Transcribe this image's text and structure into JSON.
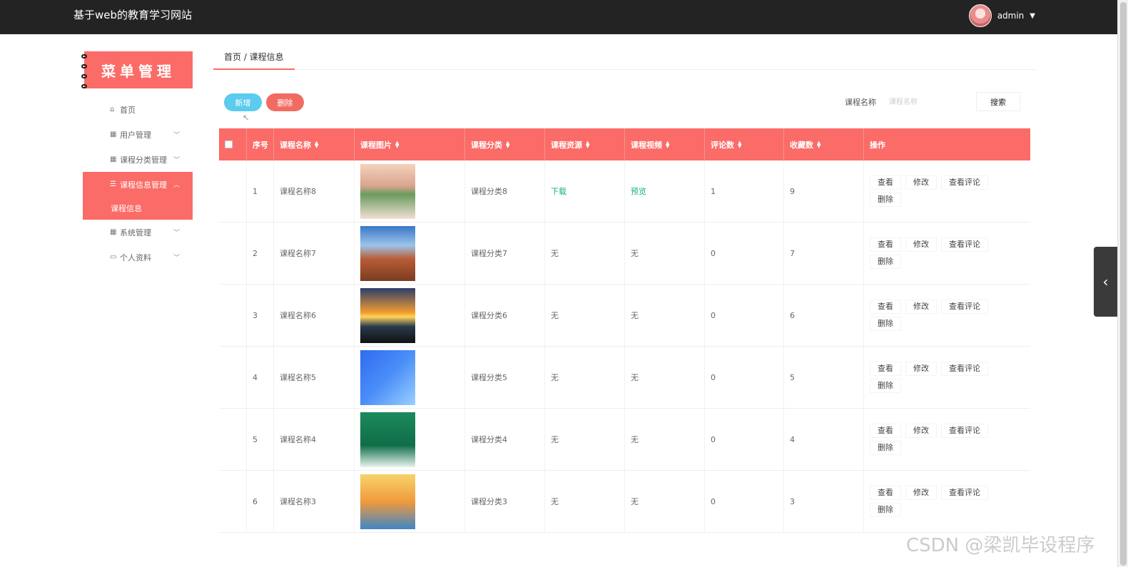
{
  "header": {
    "title": "基于web的教育学习网站",
    "username": "admin"
  },
  "sidebar": {
    "banner": "菜单管理",
    "items": [
      {
        "label": "首页",
        "icon": "home-icon"
      },
      {
        "label": "用户管理",
        "icon": "grid-icon"
      },
      {
        "label": "课程分类管理",
        "icon": "grid-icon"
      },
      {
        "label": "课程信息管理",
        "icon": "list-icon",
        "active": true,
        "sub": "课程信息"
      },
      {
        "label": "系统管理",
        "icon": "grid-icon"
      },
      {
        "label": "个人资料",
        "icon": "card-icon"
      }
    ]
  },
  "breadcrumb": "首页 / 课程信息",
  "toolbar": {
    "add_label": "新增",
    "delete_label": "删除",
    "search_label": "课程名称",
    "search_placeholder": "课程名称",
    "search_button": "搜索"
  },
  "table": {
    "columns": [
      "序号",
      "课程名称",
      "课程图片",
      "课程分类",
      "课程资源",
      "课程视频",
      "评论数",
      "收藏数",
      "操作"
    ],
    "ops": [
      "查看",
      "修改",
      "查看评论",
      "删除"
    ],
    "rows": [
      {
        "no": "1",
        "name": "课程名称8",
        "category": "课程分类8",
        "resource": "下载",
        "video": "预览",
        "comments": "1",
        "favorites": "9"
      },
      {
        "no": "2",
        "name": "课程名称7",
        "category": "课程分类7",
        "resource": "无",
        "video": "无",
        "comments": "0",
        "favorites": "7"
      },
      {
        "no": "3",
        "name": "课程名称6",
        "category": "课程分类6",
        "resource": "无",
        "video": "无",
        "comments": "0",
        "favorites": "6"
      },
      {
        "no": "4",
        "name": "课程名称5",
        "category": "课程分类5",
        "resource": "无",
        "video": "无",
        "comments": "0",
        "favorites": "5"
      },
      {
        "no": "5",
        "name": "课程名称4",
        "category": "课程分类4",
        "resource": "无",
        "video": "无",
        "comments": "0",
        "favorites": "4"
      },
      {
        "no": "6",
        "name": "课程名称3",
        "category": "课程分类3",
        "resource": "无",
        "video": "无",
        "comments": "0",
        "favorites": "3"
      }
    ]
  },
  "watermark": "CSDN @梁凯毕设程序",
  "colors": {
    "accent": "#fb6b67",
    "topbar": "#232323",
    "add_button": "#5bcbee",
    "link": "#15b36d"
  }
}
